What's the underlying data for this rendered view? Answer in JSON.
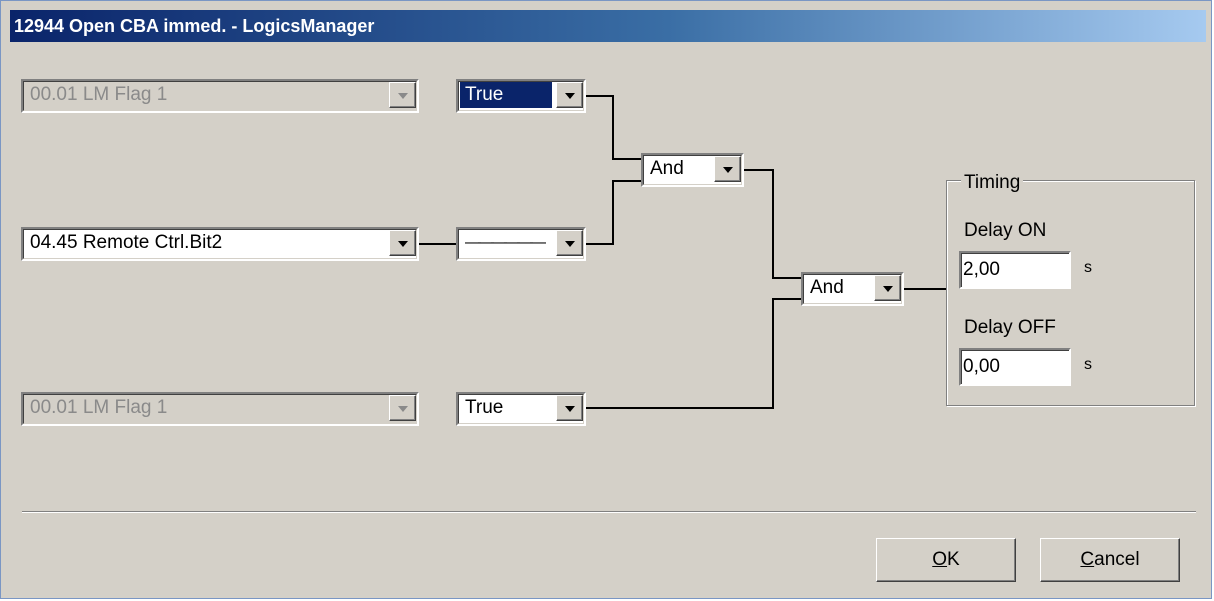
{
  "window": {
    "title": "12944 Open CBA immed. - LogicsManager"
  },
  "logic": {
    "row1": {
      "variable": "00.01 LM Flag 1",
      "variable_enabled": false,
      "sign": "True",
      "sign_selected": true
    },
    "row2": {
      "variable": "04.45 Remote Ctrl.Bit2",
      "variable_enabled": true,
      "sign": "——————"
    },
    "row3": {
      "variable": "00.01 LM Flag 1",
      "variable_enabled": false,
      "sign": "True"
    },
    "operator1": "And",
    "operator2": "And"
  },
  "timing": {
    "group_label": "Timing",
    "delay_on_label": "Delay ON",
    "delay_on_value": "2,00",
    "delay_on_unit": "s",
    "delay_off_label": "Delay OFF",
    "delay_off_value": "0,00",
    "delay_off_unit": "s"
  },
  "buttons": {
    "ok_mnemonic": "O",
    "ok_rest": "K",
    "cancel_mnemonic": "C",
    "cancel_rest": "ancel"
  },
  "colors": {
    "face": "#d4d0c8",
    "selection": "#0a246a",
    "title_start": "#0a246a",
    "title_end": "#a6caf0"
  }
}
